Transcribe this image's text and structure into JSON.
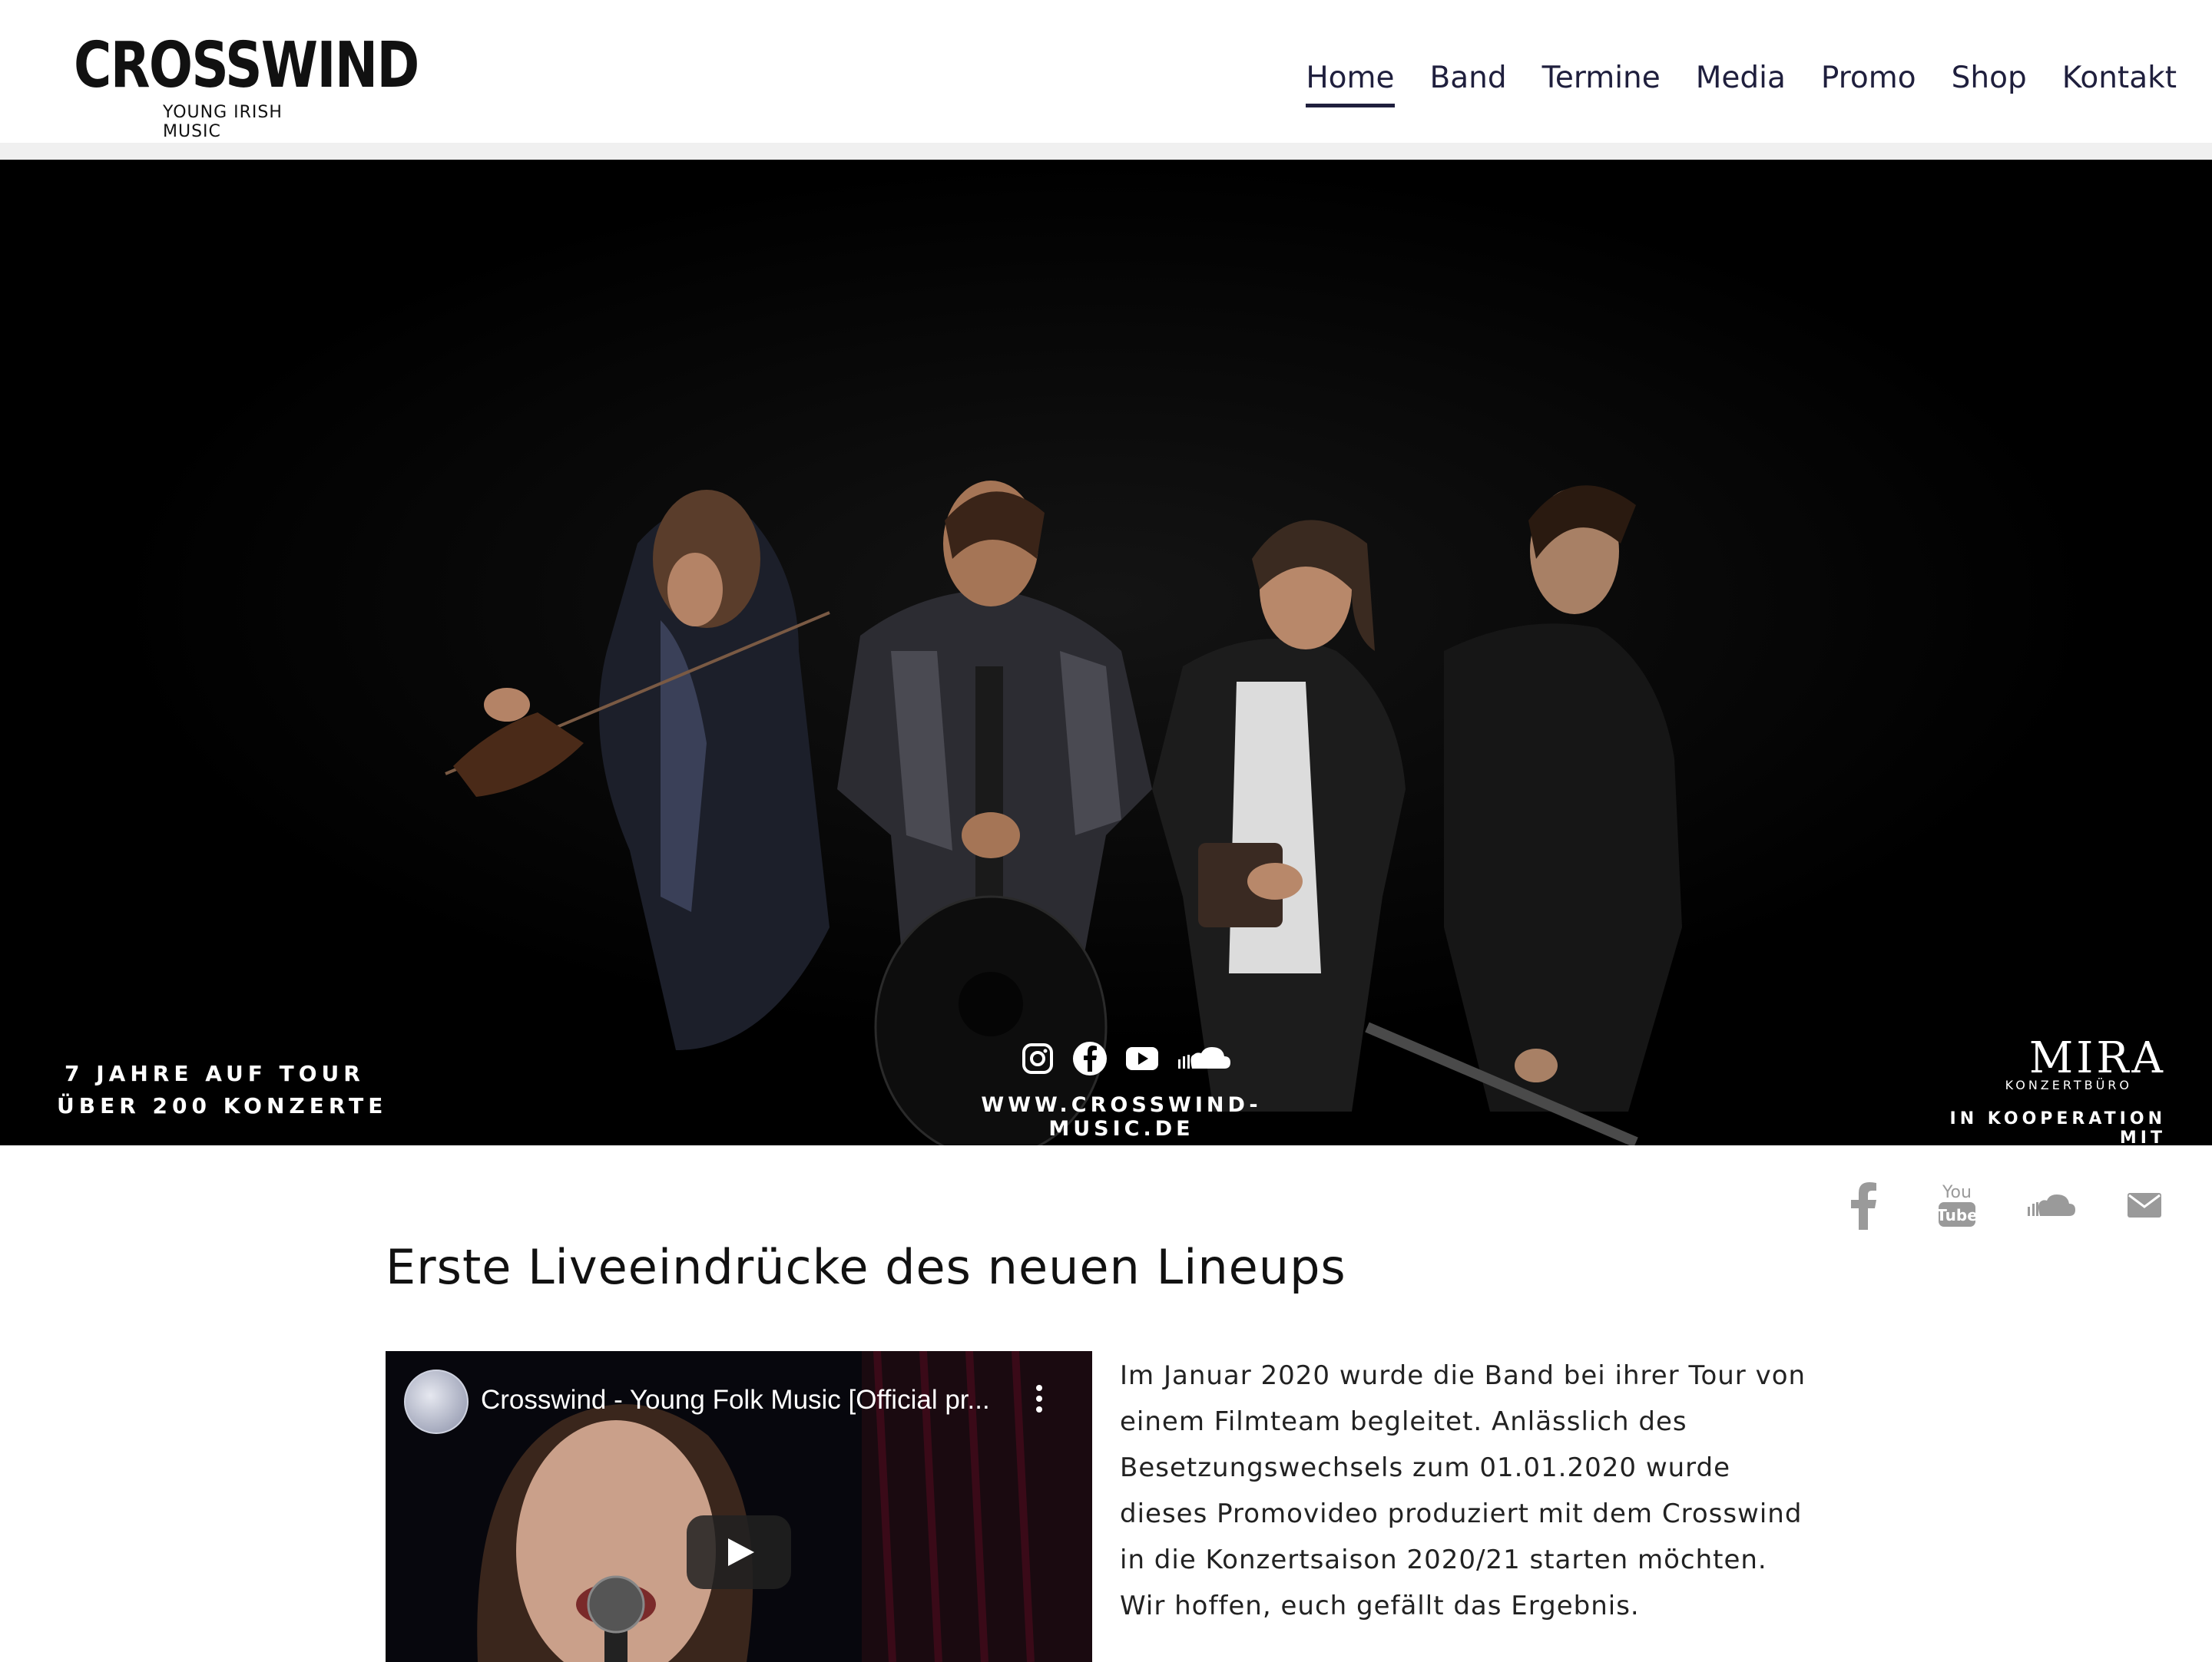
{
  "header": {
    "logo_main": "CROSSWIND",
    "logo_sub": "YOUNG IRISH MUSIC",
    "nav": [
      {
        "label": "Home",
        "active": true
      },
      {
        "label": "Band",
        "active": false
      },
      {
        "label": "Termine",
        "active": false
      },
      {
        "label": "Media",
        "active": false
      },
      {
        "label": "Promo",
        "active": false
      },
      {
        "label": "Shop",
        "active": false
      },
      {
        "label": "Kontakt",
        "active": false
      }
    ]
  },
  "hero": {
    "left_line1": "7 JAHRE AUF TOUR",
    "left_line2": "ÜBER 200 KONZERTE",
    "social_icons": [
      "instagram-icon",
      "facebook-icon",
      "youtube-icon",
      "soundcloud-icon"
    ],
    "url": "WWW.CROSSWIND-MUSIC.DE",
    "partner_logo": "MIRA",
    "partner_sub": "KONZERTBÜRO",
    "partner_caption": "IN KOOPERATION MIT"
  },
  "social_strip": {
    "icons": [
      "facebook-icon",
      "youtube-icon",
      "soundcloud-icon",
      "envelope-icon"
    ],
    "color": "#9a9a9a"
  },
  "main": {
    "headline": "Erste Liveeindrücke des neuen Lineups",
    "video": {
      "title": "Crosswind - Young Folk Music [Official pr..."
    },
    "body": "Im Januar 2020 wurde die Band bei ihrer Tour von einem Filmteam begleitet. Anlässlich des Besetzungswechsels zum 01.01.2020 wurde dieses Promovideo produziert mit dem Crosswind in die Konzertsaison 2020/21 starten möchten. Wir hoffen, euch gefällt das Ergebnis."
  }
}
